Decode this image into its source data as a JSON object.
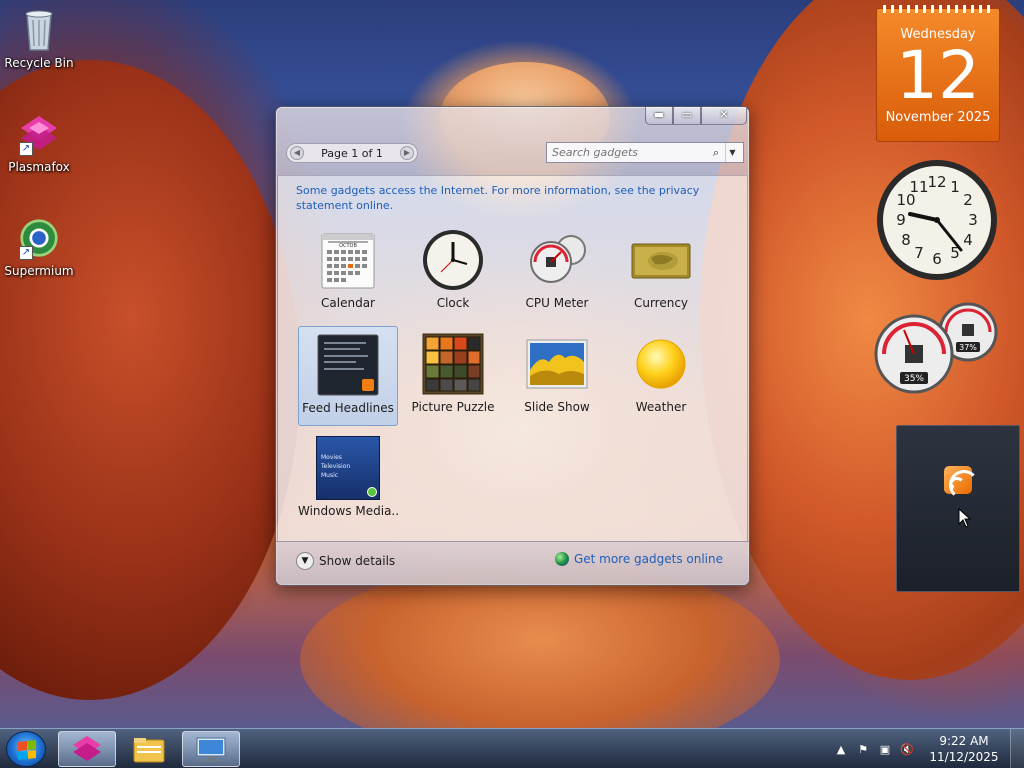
{
  "desktop": {
    "icons": [
      {
        "label": "Recycle Bin",
        "icon": "recycle-bin-icon"
      },
      {
        "label": "Plasmafox",
        "icon": "plasmafox-icon"
      },
      {
        "label": "Supermium",
        "icon": "supermium-icon"
      }
    ]
  },
  "gallery": {
    "pager_label": "Page 1 of 1",
    "search_placeholder": "Search gadgets",
    "info_text": "Some gadgets access the Internet.  For more information, see the privacy statement online.",
    "gadgets": [
      {
        "name": "Calendar",
        "icon": "calendar-icon",
        "calendar_month": "OCTOB"
      },
      {
        "name": "Clock",
        "icon": "clock-icon"
      },
      {
        "name": "CPU Meter",
        "icon": "cpu-meter-icon"
      },
      {
        "name": "Currency",
        "icon": "currency-icon"
      },
      {
        "name": "Feed Headlines",
        "icon": "feed-headlines-icon",
        "selected": true
      },
      {
        "name": "Picture Puzzle",
        "icon": "picture-puzzle-icon"
      },
      {
        "name": "Slide Show",
        "icon": "slide-show-icon"
      },
      {
        "name": "Weather",
        "icon": "weather-icon"
      },
      {
        "name": "Windows Media...",
        "icon": "windows-media-center-icon",
        "menu": [
          "Movies",
          "Television",
          "Music"
        ]
      }
    ],
    "show_details": "Show details",
    "get_more": "Get more gadgets online"
  },
  "calendar_gadget": {
    "weekday": "Wednesday",
    "day": "12",
    "month_year": "November 2025"
  },
  "clock_gadget": {
    "numbers": [
      "12",
      "1",
      "2",
      "3",
      "4",
      "5",
      "6",
      "7",
      "8",
      "9",
      "10",
      "11"
    ]
  },
  "cpu_gadget": {
    "cpu_percent": "35%",
    "memory_percent": "37%"
  },
  "taskbar": {
    "clock_time": "9:22 AM",
    "clock_date": "11/12/2025",
    "buttons": [
      {
        "name": "plasmafox-taskbar-icon"
      },
      {
        "name": "file-explorer-taskbar-icon"
      },
      {
        "name": "remote-desktop-taskbar-icon"
      }
    ]
  },
  "colors": {
    "link": "#1f5fb8",
    "calendar_orange": "#f0781c",
    "accent_selection": "#7da2ce"
  }
}
